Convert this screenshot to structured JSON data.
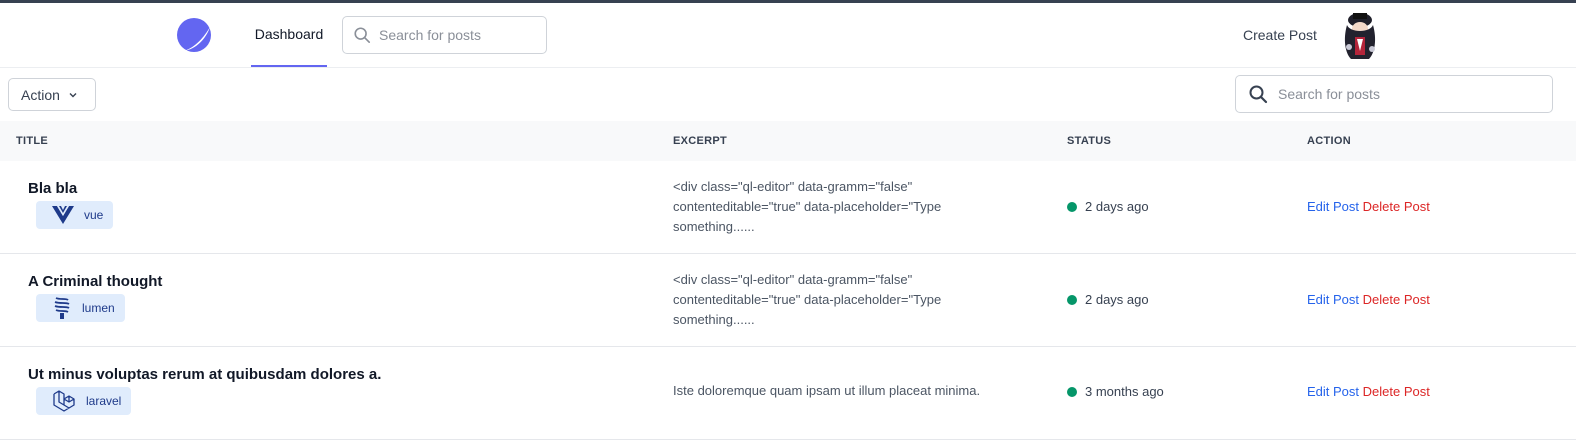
{
  "nav": {
    "tab_dashboard": "Dashboard",
    "search_placeholder": "Search for posts",
    "create_post": "Create Post"
  },
  "toolbar": {
    "action_label": "Action",
    "search_placeholder": "Search for posts"
  },
  "table": {
    "headers": [
      "TITLE",
      "EXCERPT",
      "STATUS",
      "ACTION"
    ],
    "rows": [
      {
        "title": "Bla bla",
        "tag": "vue",
        "tag_icon": "vue-icon",
        "excerpt": "<div class=\"ql-editor\" data-gramm=\"false\" contenteditable=\"true\" data-placeholder=\"Type something......",
        "status": "2 days ago",
        "edit": "Edit Post",
        "delete": "Delete Post"
      },
      {
        "title": "A Criminal thought",
        "tag": "lumen",
        "tag_icon": "lumen-icon",
        "excerpt": "<div class=\"ql-editor\" data-gramm=\"false\" contenteditable=\"true\" data-placeholder=\"Type something......",
        "status": "2 days ago",
        "edit": "Edit Post",
        "delete": "Delete Post"
      },
      {
        "title": "Ut minus voluptas rerum at quibusdam dolores a.",
        "tag": "laravel",
        "tag_icon": "laravel-icon",
        "excerpt": "Iste doloremque quam ipsam ut illum placeat minima.",
        "status": "3 months ago",
        "edit": "Edit Post",
        "delete": "Delete Post"
      }
    ]
  },
  "colors": {
    "accent": "#6366f1",
    "link": "#2563eb",
    "danger": "#dc2626",
    "status_dot": "#059669",
    "tag_bg": "#e0ecfc"
  }
}
